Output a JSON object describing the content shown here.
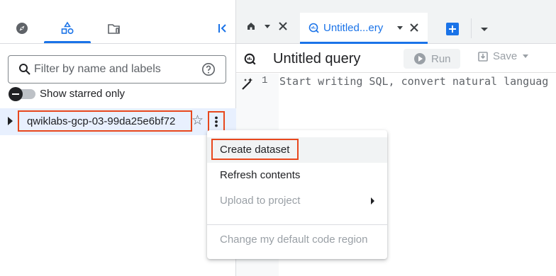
{
  "left_panel": {
    "nav_icons": [
      "explorer-icon",
      "resources-icon",
      "classic-explorer-icon"
    ],
    "collapse_icon": "collapse-left-icon",
    "filter": {
      "placeholder": "Filter by name and labels",
      "value": ""
    },
    "starred_toggle": {
      "label": "Show starred only",
      "on": false
    },
    "project": {
      "name": "qwiklabs-gcp-03-99da25e6bf72",
      "starred": false
    }
  },
  "tabs": {
    "home_tab": {
      "icon": "home-icon"
    },
    "active_tab": {
      "label": "Untitled...ery"
    }
  },
  "query_header": {
    "title": "Untitled query",
    "run_label": "Run",
    "save_label": "Save"
  },
  "editor": {
    "line_number": "1",
    "hint": "Start writing SQL, convert natural languag"
  },
  "context_menu": {
    "items": [
      {
        "label": "Create dataset",
        "enabled": true
      },
      {
        "label": "Refresh contents",
        "enabled": true
      },
      {
        "label": "Upload to project",
        "enabled": false,
        "submenu": true
      },
      {
        "label": "Change my default code region",
        "enabled": false
      }
    ]
  },
  "colors": {
    "accent": "#1a73e8",
    "highlight_box": "#e8471d",
    "selected_row": "#e8f0fe",
    "disabled_text": "#9aa0a6"
  }
}
